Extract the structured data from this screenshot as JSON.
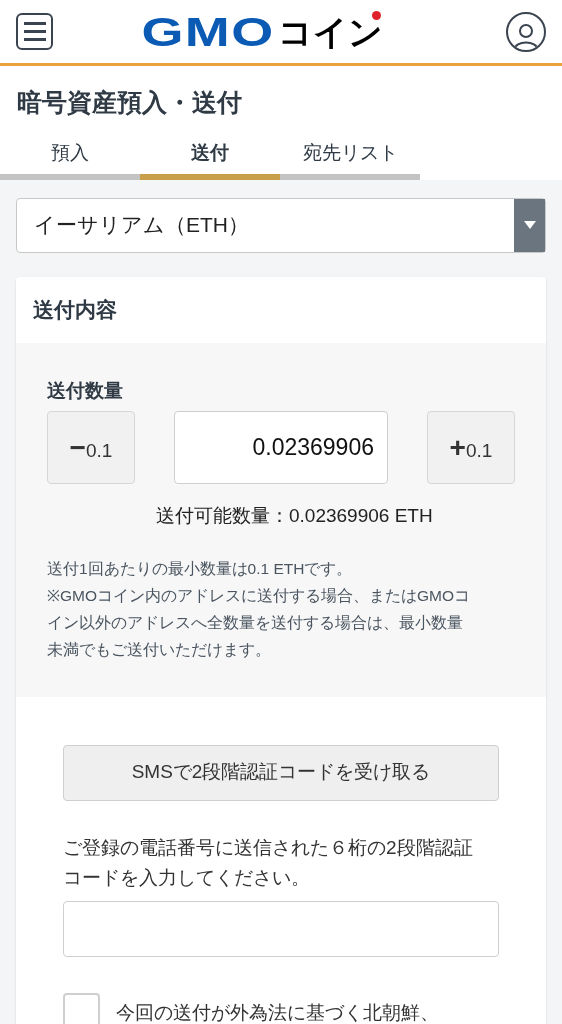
{
  "header": {
    "logo": {
      "latin": "GMO",
      "kana": "コイン"
    }
  },
  "title": "暗号資産預入・送付",
  "tabs": [
    {
      "label": "預入",
      "selected": false
    },
    {
      "label": "送付",
      "selected": true
    },
    {
      "label": "宛先リスト",
      "selected": false
    }
  ],
  "currency_select": {
    "value": "イーサリアム（ETH）"
  },
  "card": {
    "title": "送付内容",
    "quantity": {
      "label": "送付数量",
      "minus": {
        "sign": "−",
        "step": "0.1"
      },
      "value": "0.02369906",
      "plus": {
        "sign": "+",
        "step": "0.1"
      },
      "available": "送付可能数量：0.02369906 ETH"
    },
    "notes": [
      "送付1回あたりの最小数量は0.1 ETHです。",
      "※GMOコイン内のアドレスに送付する場合、またはGMOコイン以外のアドレスへ全数量を送付する場合は、最小数量未満でもご送付いただけます。"
    ],
    "sms_button": "SMSで2段階認証コードを受け取る",
    "code_instruction": "ご登録の電話番号に送信された６桁の2段階認証コードを入力してください。",
    "confirm": {
      "label": "今回の送付が外為法に基づく北朝鮮、",
      "checked": false
    }
  }
}
